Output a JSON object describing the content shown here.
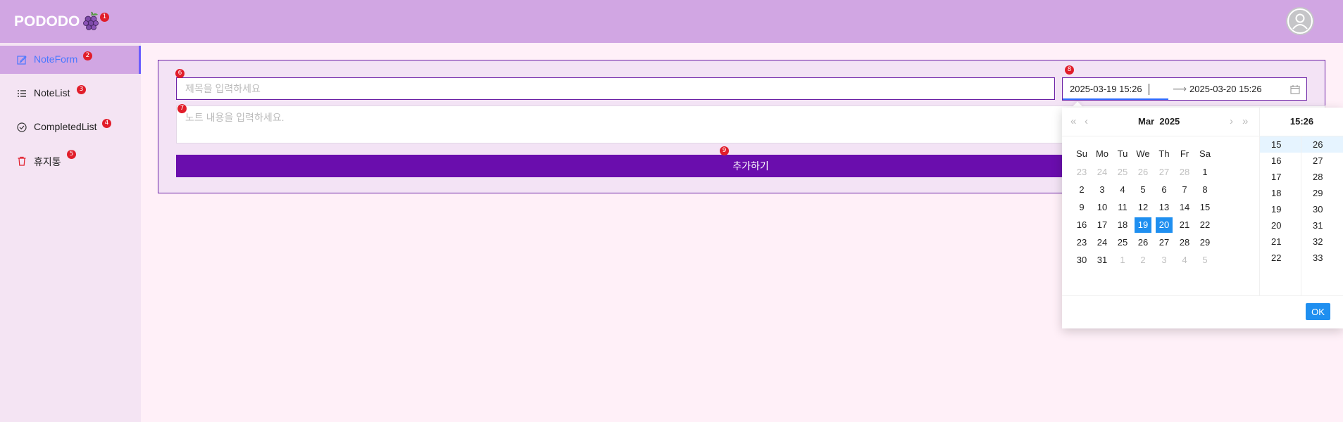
{
  "header": {
    "brand": "PODODO",
    "badge": "1"
  },
  "sidebar": {
    "items": [
      {
        "label": "NoteForm",
        "badge": "2",
        "icon": "edit-icon",
        "active": true
      },
      {
        "label": "NoteList",
        "badge": "3",
        "icon": "list-icon"
      },
      {
        "label": "CompletedList",
        "badge": "4",
        "icon": "check-circle-icon"
      },
      {
        "label": "휴지통",
        "badge": "5",
        "icon": "trash-icon"
      }
    ]
  },
  "form": {
    "title_placeholder": "제목을 입력하세요",
    "title_badge": "6",
    "content_placeholder": "노트 내용을 입력하세요.",
    "content_badge": "7",
    "range_badge": "8",
    "range_start": "2025-03-19 15:26",
    "range_end": "2025-03-20 15:26",
    "submit_label": "추가하기",
    "submit_badge": "9"
  },
  "picker": {
    "month": "Mar",
    "year": "2025",
    "weekdays": [
      "Su",
      "Mo",
      "Tu",
      "We",
      "Th",
      "Fr",
      "Sa"
    ],
    "days": [
      [
        "23",
        "24",
        "25",
        "26",
        "27",
        "28",
        "1"
      ],
      [
        "2",
        "3",
        "4",
        "5",
        "6",
        "7",
        "8"
      ],
      [
        "9",
        "10",
        "11",
        "12",
        "13",
        "14",
        "15"
      ],
      [
        "16",
        "17",
        "18",
        "19",
        "20",
        "21",
        "22"
      ],
      [
        "23",
        "24",
        "25",
        "26",
        "27",
        "28",
        "29"
      ],
      [
        "30",
        "31",
        "1",
        "2",
        "3",
        "4",
        "5"
      ]
    ],
    "selected_days": [
      "19",
      "20"
    ],
    "time": "15:26",
    "hours": [
      "15",
      "16",
      "17",
      "18",
      "19",
      "20",
      "21",
      "22"
    ],
    "minutes": [
      "26",
      "27",
      "28",
      "29",
      "30",
      "31",
      "32",
      "33"
    ],
    "ok_label": "OK"
  },
  "colors": {
    "header": "#d1a6e3",
    "sidebar": "#f4e4f3",
    "primary": "#6a0dad",
    "accent": "#1f8ff0",
    "badge": "#e11d2a"
  }
}
